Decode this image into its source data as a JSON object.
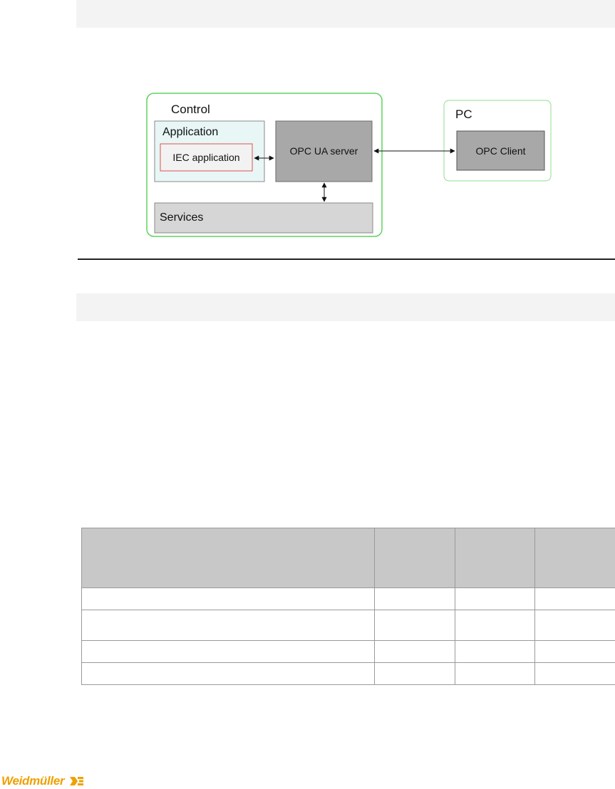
{
  "diagram": {
    "control": {
      "title": "Control"
    },
    "application": {
      "title": "Application"
    },
    "iec_application": {
      "label": "IEC application"
    },
    "opc_ua_server": {
      "label": "OPC UA server"
    },
    "services": {
      "label": "Services"
    },
    "pc": {
      "title": "PC"
    },
    "opc_client": {
      "label": "OPC Client"
    },
    "colors": {
      "group_border": "#5fd35f",
      "application_fill": "#e8f6f6",
      "iec_border": "#e05050",
      "server_fill": "#a8a8a8",
      "services_fill": "#d6d6d6"
    }
  },
  "table": {
    "header": [
      "",
      "",
      "",
      ""
    ],
    "rows": [
      [
        "",
        "",
        "",
        ""
      ],
      [
        "",
        "",
        "",
        ""
      ],
      [
        "",
        "",
        "",
        ""
      ],
      [
        "",
        "",
        "",
        ""
      ]
    ]
  },
  "footer": {
    "logo_text": "Weidmüller",
    "logo_color": "#f0a000"
  }
}
